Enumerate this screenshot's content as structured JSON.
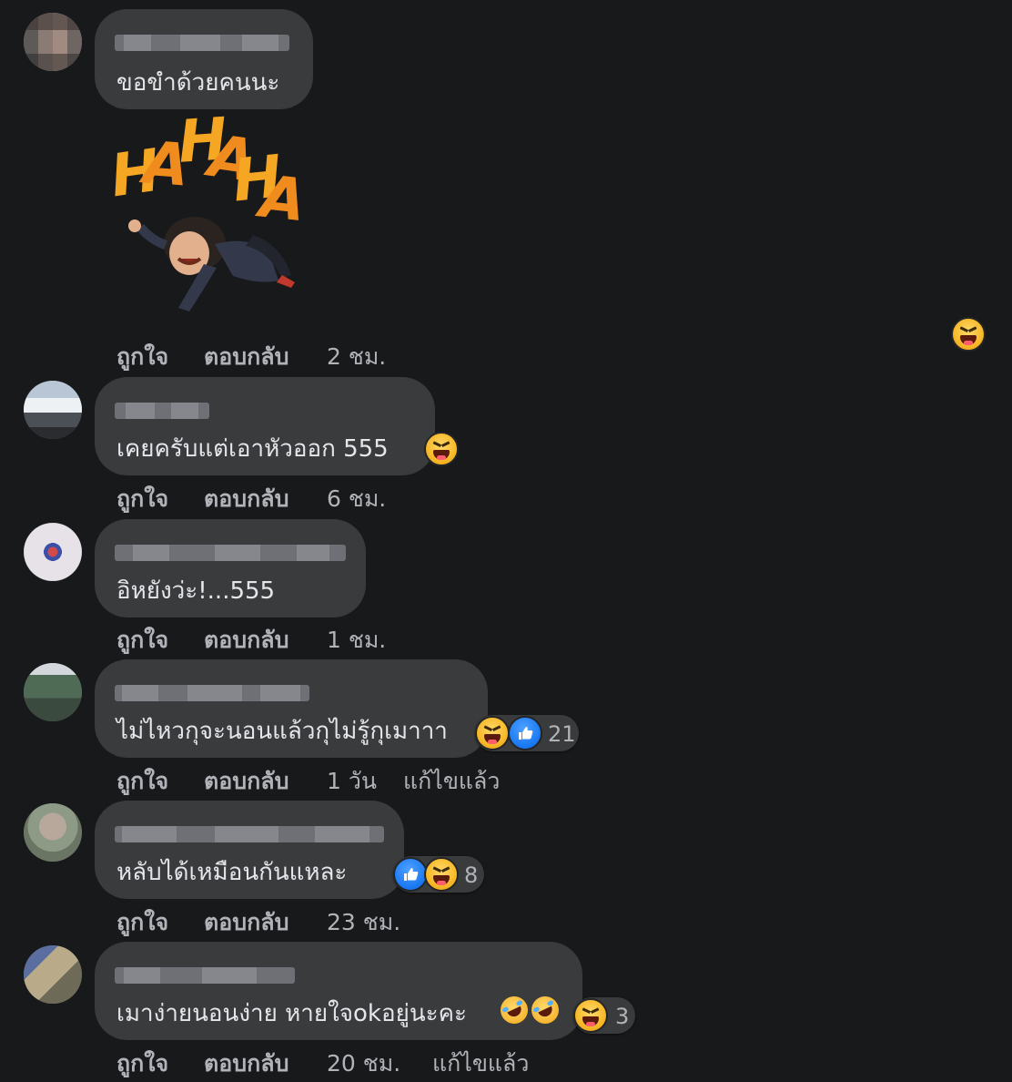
{
  "comments": [
    {
      "text": "ขอขำด้วยคนนะ",
      "sticker": {
        "letters": [
          "H",
          "A",
          "H",
          "A",
          "H",
          "A"
        ],
        "description_icon": "laughing-avatar-sticker"
      },
      "actions": {
        "like": "ถูกใจ",
        "reply": "ตอบกลับ",
        "time": "2 ชม."
      },
      "reaction_icon": "haha-icon"
    },
    {
      "text": "เคยครับแต่เอาหัวออก 555",
      "actions": {
        "like": "ถูกใจ",
        "reply": "ตอบกลับ",
        "time": "6 ชม."
      }
    },
    {
      "text": "อิหยังว่ะ!...555",
      "actions": {
        "like": "ถูกใจ",
        "reply": "ตอบกลับ",
        "time": "1 ชม."
      }
    },
    {
      "text": "ไม่ไหวกุจะนอนแล้วกุไม่รู้กุเมาาา",
      "reactions": {
        "count": "21",
        "icons": [
          "haha-icon",
          "like-icon"
        ]
      },
      "actions": {
        "like": "ถูกใจ",
        "reply": "ตอบกลับ",
        "time": "1 วัน",
        "edited": "แก้ไขแล้ว"
      }
    },
    {
      "text": "หลับได้เหมือนกันแหละ",
      "reactions": {
        "count": "8",
        "icons": [
          "like-icon",
          "haha-icon"
        ]
      },
      "actions": {
        "like": "ถูกใจ",
        "reply": "ตอบกลับ",
        "time": "23 ชม."
      }
    },
    {
      "text": "เมาง่ายนอนง่าย หายใจokอยู่นะคะ",
      "trailing_emoji": [
        "rofl-icon",
        "rofl-icon"
      ],
      "reactions": {
        "count": "3",
        "icons": [
          "haha-icon"
        ]
      },
      "actions": {
        "like": "ถูกใจ",
        "reply": "ตอบกลับ",
        "time": "20 ชม.",
        "edited": "แก้ไขแล้ว"
      }
    }
  ],
  "colors": {
    "background": "#18191a",
    "bubble": "#3a3b3c",
    "text": "#e4e6eb",
    "secondary": "#b0b3b8",
    "like": "#1877f2",
    "haha": "#f7b928"
  }
}
